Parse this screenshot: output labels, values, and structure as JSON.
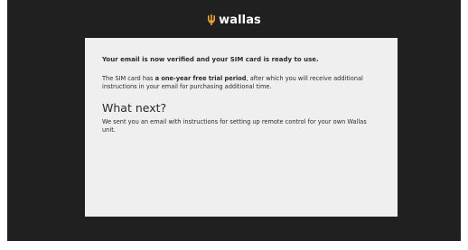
{
  "brand": {
    "name": "wallas",
    "icon": "wallas-flame-logo-icon",
    "accent_color": "#f0a32a"
  },
  "card": {
    "headline": "Your email is now verified and your SIM card is ready to use.",
    "trial": {
      "prefix": "The SIM card has ",
      "bold": "a one-year free trial period",
      "suffix": ", after which you will receive additional instructions in your email for purchasing additional time."
    },
    "next_title": "What next?",
    "next_text": "We sent you an email with instructions for setting up remote control for your own Wallas unit."
  },
  "colors": {
    "background": "#202020",
    "card": "#efefef",
    "text": "#2a2a2a"
  }
}
